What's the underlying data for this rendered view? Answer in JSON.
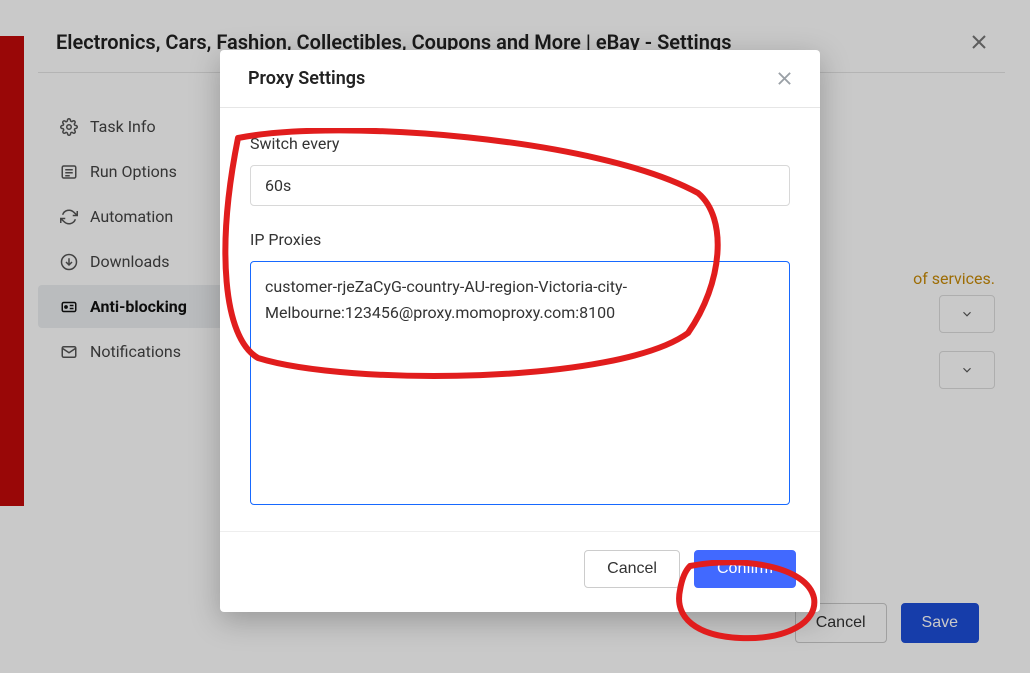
{
  "panel": {
    "title": "Electronics, Cars, Fashion, Collectibles, Coupons and More | eBay - Settings",
    "notice": "of services.",
    "cancel": "Cancel",
    "save": "Save"
  },
  "sidebar": {
    "items": [
      {
        "label": "Task Info"
      },
      {
        "label": "Run Options"
      },
      {
        "label": "Automation"
      },
      {
        "label": "Downloads"
      },
      {
        "label": "Anti-blocking"
      },
      {
        "label": "Notifications"
      }
    ]
  },
  "modal": {
    "title": "Proxy Settings",
    "switch_label": "Switch every",
    "switch_value": "60s",
    "proxies_label": "IP Proxies",
    "proxies_value": "customer-rjeZaCyG-country-AU-region-Victoria-city-Melbourne:123456@proxy.momoproxy.com:8100",
    "cancel": "Cancel",
    "confirm": "Confirm"
  }
}
